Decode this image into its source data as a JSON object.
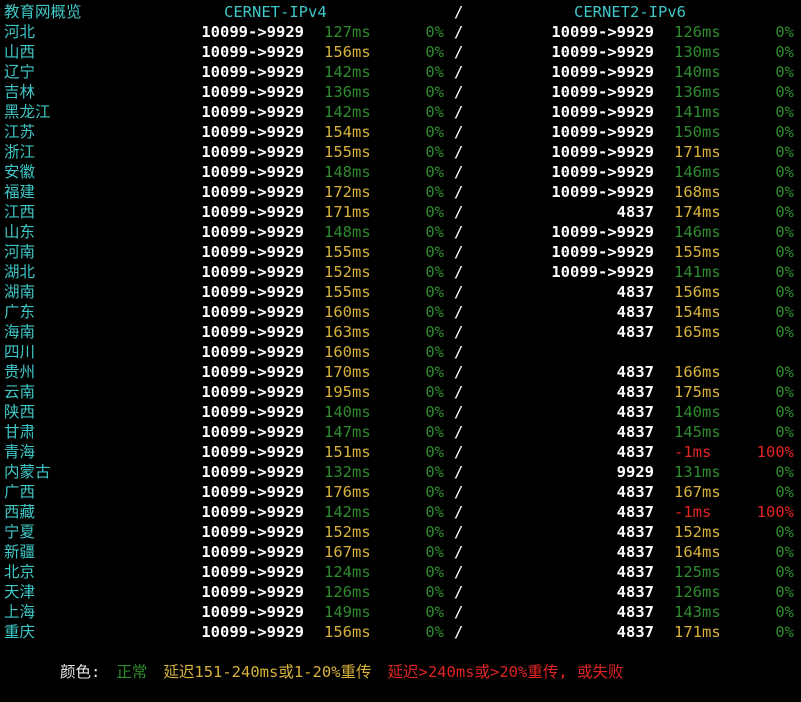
{
  "header": {
    "title": "教育网概览",
    "ipv4": "CERNET-IPv4",
    "sep": "/",
    "ipv6": "CERNET2-IPv6"
  },
  "colors": {
    "good": "#2e8b2e",
    "mid": "#d8b23a",
    "bad": "#e02424",
    "cyan": "#3fc6c6"
  },
  "rows": [
    {
      "prov": "河北",
      "r4": "10099->9929",
      "l4": "127ms",
      "l4s": "good",
      "k4": "0%",
      "k4s": "good",
      "r6": "10099->9929",
      "l6": "126ms",
      "l6s": "good",
      "k6": "0%",
      "k6s": "good"
    },
    {
      "prov": "山西",
      "r4": "10099->9929",
      "l4": "156ms",
      "l4s": "mid",
      "k4": "0%",
      "k4s": "good",
      "r6": "10099->9929",
      "l6": "130ms",
      "l6s": "good",
      "k6": "0%",
      "k6s": "good"
    },
    {
      "prov": "辽宁",
      "r4": "10099->9929",
      "l4": "142ms",
      "l4s": "good",
      "k4": "0%",
      "k4s": "good",
      "r6": "10099->9929",
      "l6": "140ms",
      "l6s": "good",
      "k6": "0%",
      "k6s": "good"
    },
    {
      "prov": "吉林",
      "r4": "10099->9929",
      "l4": "136ms",
      "l4s": "good",
      "k4": "0%",
      "k4s": "good",
      "r6": "10099->9929",
      "l6": "136ms",
      "l6s": "good",
      "k6": "0%",
      "k6s": "good"
    },
    {
      "prov": "黑龙江",
      "r4": "10099->9929",
      "l4": "142ms",
      "l4s": "good",
      "k4": "0%",
      "k4s": "good",
      "r6": "10099->9929",
      "l6": "141ms",
      "l6s": "good",
      "k6": "0%",
      "k6s": "good"
    },
    {
      "prov": "江苏",
      "r4": "10099->9929",
      "l4": "154ms",
      "l4s": "mid",
      "k4": "0%",
      "k4s": "good",
      "r6": "10099->9929",
      "l6": "150ms",
      "l6s": "good",
      "k6": "0%",
      "k6s": "good"
    },
    {
      "prov": "浙江",
      "r4": "10099->9929",
      "l4": "155ms",
      "l4s": "mid",
      "k4": "0%",
      "k4s": "good",
      "r6": "10099->9929",
      "l6": "171ms",
      "l6s": "mid",
      "k6": "0%",
      "k6s": "good"
    },
    {
      "prov": "安徽",
      "r4": "10099->9929",
      "l4": "148ms",
      "l4s": "good",
      "k4": "0%",
      "k4s": "good",
      "r6": "10099->9929",
      "l6": "146ms",
      "l6s": "good",
      "k6": "0%",
      "k6s": "good"
    },
    {
      "prov": "福建",
      "r4": "10099->9929",
      "l4": "172ms",
      "l4s": "mid",
      "k4": "0%",
      "k4s": "good",
      "r6": "10099->9929",
      "l6": "168ms",
      "l6s": "mid",
      "k6": "0%",
      "k6s": "good"
    },
    {
      "prov": "江西",
      "r4": "10099->9929",
      "l4": "171ms",
      "l4s": "mid",
      "k4": "0%",
      "k4s": "good",
      "r6": "4837",
      "l6": "174ms",
      "l6s": "mid",
      "k6": "0%",
      "k6s": "good"
    },
    {
      "prov": "山东",
      "r4": "10099->9929",
      "l4": "148ms",
      "l4s": "good",
      "k4": "0%",
      "k4s": "good",
      "r6": "10099->9929",
      "l6": "146ms",
      "l6s": "good",
      "k6": "0%",
      "k6s": "good"
    },
    {
      "prov": "河南",
      "r4": "10099->9929",
      "l4": "155ms",
      "l4s": "mid",
      "k4": "0%",
      "k4s": "good",
      "r6": "10099->9929",
      "l6": "155ms",
      "l6s": "mid",
      "k6": "0%",
      "k6s": "good"
    },
    {
      "prov": "湖北",
      "r4": "10099->9929",
      "l4": "152ms",
      "l4s": "mid",
      "k4": "0%",
      "k4s": "good",
      "r6": "10099->9929",
      "l6": "141ms",
      "l6s": "good",
      "k6": "0%",
      "k6s": "good"
    },
    {
      "prov": "湖南",
      "r4": "10099->9929",
      "l4": "155ms",
      "l4s": "mid",
      "k4": "0%",
      "k4s": "good",
      "r6": "4837",
      "l6": "156ms",
      "l6s": "mid",
      "k6": "0%",
      "k6s": "good"
    },
    {
      "prov": "广东",
      "r4": "10099->9929",
      "l4": "160ms",
      "l4s": "mid",
      "k4": "0%",
      "k4s": "good",
      "r6": "4837",
      "l6": "154ms",
      "l6s": "mid",
      "k6": "0%",
      "k6s": "good"
    },
    {
      "prov": "海南",
      "r4": "10099->9929",
      "l4": "163ms",
      "l4s": "mid",
      "k4": "0%",
      "k4s": "good",
      "r6": "4837",
      "l6": "165ms",
      "l6s": "mid",
      "k6": "0%",
      "k6s": "good"
    },
    {
      "prov": "四川",
      "r4": "10099->9929",
      "l4": "160ms",
      "l4s": "mid",
      "k4": "0%",
      "k4s": "good",
      "r6": "",
      "l6": "",
      "l6s": "good",
      "k6": "",
      "k6s": "good"
    },
    {
      "prov": "贵州",
      "r4": "10099->9929",
      "l4": "170ms",
      "l4s": "mid",
      "k4": "0%",
      "k4s": "good",
      "r6": "4837",
      "l6": "166ms",
      "l6s": "mid",
      "k6": "0%",
      "k6s": "good"
    },
    {
      "prov": "云南",
      "r4": "10099->9929",
      "l4": "195ms",
      "l4s": "mid",
      "k4": "0%",
      "k4s": "good",
      "r6": "4837",
      "l6": "175ms",
      "l6s": "mid",
      "k6": "0%",
      "k6s": "good"
    },
    {
      "prov": "陕西",
      "r4": "10099->9929",
      "l4": "140ms",
      "l4s": "good",
      "k4": "0%",
      "k4s": "good",
      "r6": "4837",
      "l6": "140ms",
      "l6s": "good",
      "k6": "0%",
      "k6s": "good"
    },
    {
      "prov": "甘肃",
      "r4": "10099->9929",
      "l4": "147ms",
      "l4s": "good",
      "k4": "0%",
      "k4s": "good",
      "r6": "4837",
      "l6": "145ms",
      "l6s": "good",
      "k6": "0%",
      "k6s": "good"
    },
    {
      "prov": "青海",
      "r4": "10099->9929",
      "l4": "151ms",
      "l4s": "mid",
      "k4": "0%",
      "k4s": "good",
      "r6": "4837",
      "l6": "-1ms",
      "l6s": "bad",
      "k6": "100%",
      "k6s": "bad"
    },
    {
      "prov": "内蒙古",
      "r4": "10099->9929",
      "l4": "132ms",
      "l4s": "good",
      "k4": "0%",
      "k4s": "good",
      "r6": "9929",
      "l6": "131ms",
      "l6s": "good",
      "k6": "0%",
      "k6s": "good"
    },
    {
      "prov": "广西",
      "r4": "10099->9929",
      "l4": "176ms",
      "l4s": "mid",
      "k4": "0%",
      "k4s": "good",
      "r6": "4837",
      "l6": "167ms",
      "l6s": "mid",
      "k6": "0%",
      "k6s": "good"
    },
    {
      "prov": "西藏",
      "r4": "10099->9929",
      "l4": "142ms",
      "l4s": "good",
      "k4": "0%",
      "k4s": "good",
      "r6": "4837",
      "l6": "-1ms",
      "l6s": "bad",
      "k6": "100%",
      "k6s": "bad"
    },
    {
      "prov": "宁夏",
      "r4": "10099->9929",
      "l4": "152ms",
      "l4s": "mid",
      "k4": "0%",
      "k4s": "good",
      "r6": "4837",
      "l6": "152ms",
      "l6s": "mid",
      "k6": "0%",
      "k6s": "good"
    },
    {
      "prov": "新疆",
      "r4": "10099->9929",
      "l4": "167ms",
      "l4s": "mid",
      "k4": "0%",
      "k4s": "good",
      "r6": "4837",
      "l6": "164ms",
      "l6s": "mid",
      "k6": "0%",
      "k6s": "good"
    },
    {
      "prov": "北京",
      "r4": "10099->9929",
      "l4": "124ms",
      "l4s": "good",
      "k4": "0%",
      "k4s": "good",
      "r6": "4837",
      "l6": "125ms",
      "l6s": "good",
      "k6": "0%",
      "k6s": "good"
    },
    {
      "prov": "天津",
      "r4": "10099->9929",
      "l4": "126ms",
      "l4s": "good",
      "k4": "0%",
      "k4s": "good",
      "r6": "4837",
      "l6": "126ms",
      "l6s": "good",
      "k6": "0%",
      "k6s": "good"
    },
    {
      "prov": "上海",
      "r4": "10099->9929",
      "l4": "149ms",
      "l4s": "good",
      "k4": "0%",
      "k4s": "good",
      "r6": "4837",
      "l6": "143ms",
      "l6s": "good",
      "k6": "0%",
      "k6s": "good"
    },
    {
      "prov": "重庆",
      "r4": "10099->9929",
      "l4": "156ms",
      "l4s": "mid",
      "k4": "0%",
      "k4s": "good",
      "r6": "4837",
      "l6": "171ms",
      "l6s": "mid",
      "k6": "0%",
      "k6s": "good"
    }
  ],
  "legend": {
    "label": "颜色:",
    "good": "正常",
    "mid": "延迟151-240ms或1-20%重传",
    "bad": "延迟>240ms或>20%重传, 或失败"
  }
}
